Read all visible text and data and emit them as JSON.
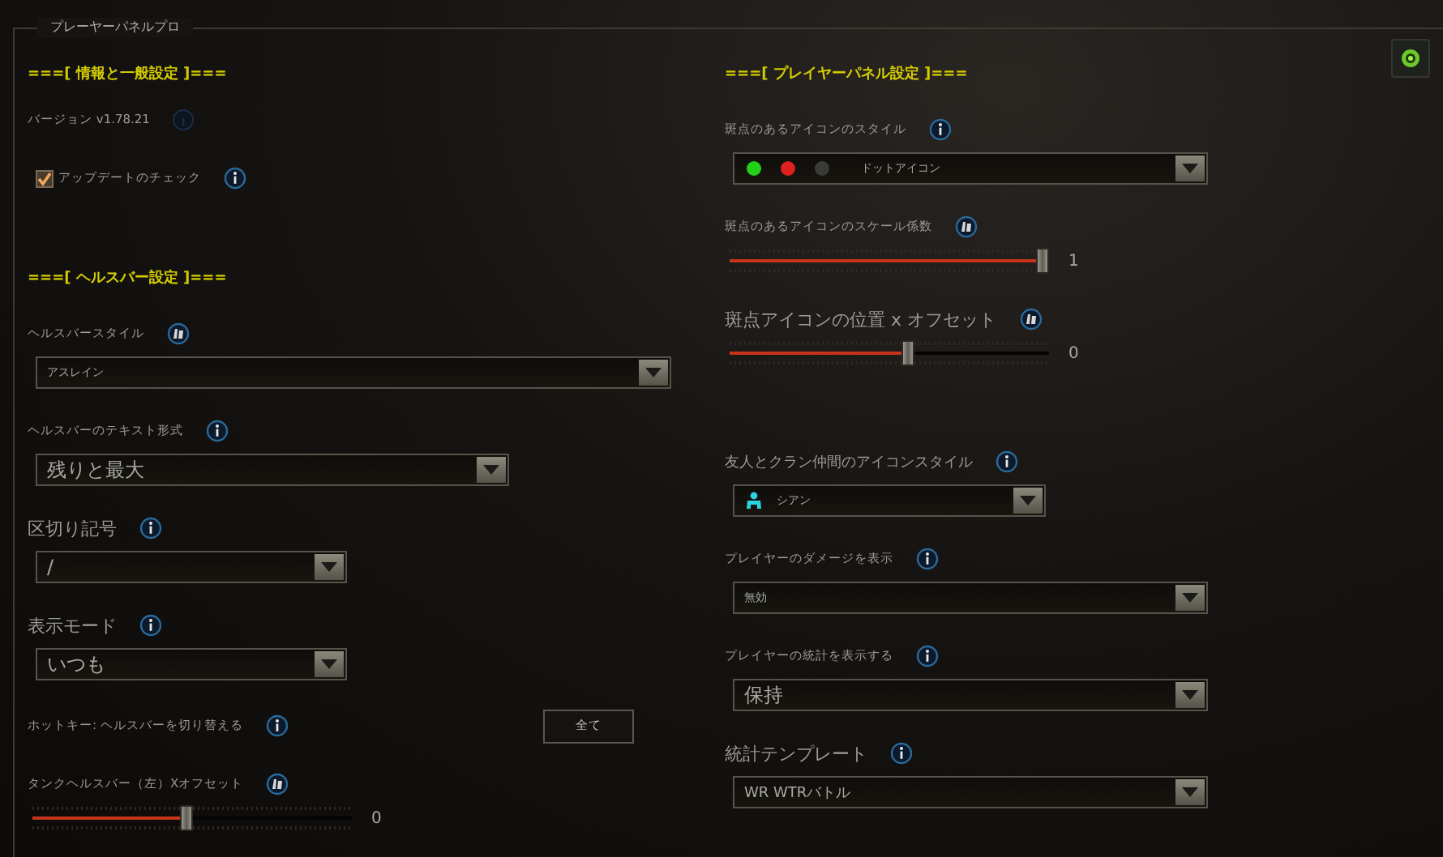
{
  "panel": {
    "title": "プレーヤーパネルプロ"
  },
  "left": [
    {
      "kind": "heading",
      "text": "===[ 情報と一般設定 ]==="
    },
    {
      "kind": "text",
      "text": "バージョン v1.78.21"
    },
    {
      "kind": "checkbox",
      "label": "アップデートのチェック",
      "checked": true
    },
    {
      "kind": "heading",
      "text": "===[ ヘルスバー設定 ]==="
    },
    {
      "kind": "dropdown",
      "label": "ヘルスバースタイル",
      "value": "アスレイン"
    },
    {
      "kind": "dropdown",
      "label": "ヘルスバーのテキスト形式",
      "value": "残りと最大"
    },
    {
      "kind": "dropdown",
      "label": "区切り記号",
      "value": "/"
    },
    {
      "kind": "dropdown",
      "label": "表示モード",
      "value": "いつも"
    },
    {
      "kind": "button_row",
      "label": "ホットキー: ヘルスバーを切り替える",
      "button": "全て"
    },
    {
      "kind": "slider",
      "label": "タンクヘルスバー（左）Xオフセット",
      "level": 0.48,
      "reading": "0"
    }
  ],
  "right": [
    {
      "kind": "heading",
      "text": "===[ プレイヤーパネル設定 ]==="
    },
    {
      "kind": "dropdown",
      "label": "斑点のあるアイコンのスタイル",
      "value": "ドットアイコン"
    },
    {
      "kind": "slider",
      "label": "斑点のあるアイコンのスケール係数",
      "level": 0.98,
      "reading": "1"
    },
    {
      "kind": "slider",
      "label": "斑点アイコンの位置 x オフセット",
      "level": 0.56,
      "reading": "0"
    },
    {
      "kind": "dropdown",
      "label": "友人とクラン仲間のアイコンスタイル",
      "value": "シアン"
    },
    {
      "kind": "dropdown",
      "label": "プレイヤーのダメージを表示",
      "value": "無効"
    },
    {
      "kind": "dropdown",
      "label": "プレイヤーの統計を表示する",
      "value": "保持"
    },
    {
      "kind": "dropdown",
      "label": "統計テンプレート",
      "value": "WR WTRバトル"
    }
  ]
}
